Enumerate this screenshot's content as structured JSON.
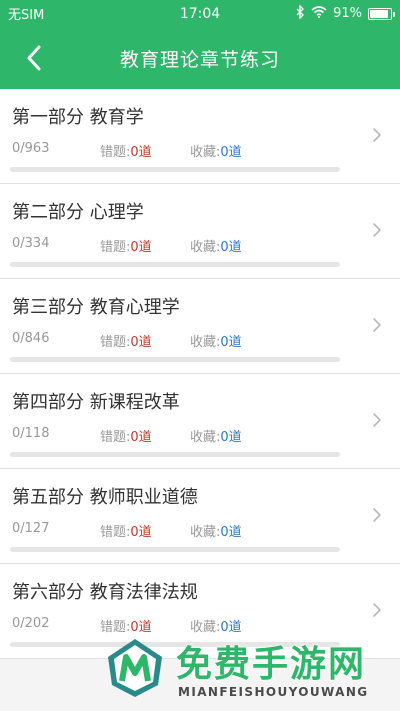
{
  "status_bar": {
    "carrier": "无SIM",
    "time": "17:04",
    "battery_percent": "91%",
    "battery_level": 0.91
  },
  "header": {
    "title": "教育理论章节练习"
  },
  "labels": {
    "wrong": "错题:",
    "fav": "收藏:"
  },
  "sections": [
    {
      "title": "第一部分 教育学",
      "progress": "0/963",
      "wrong": "0道",
      "fav": "0道",
      "done": 0
    },
    {
      "title": "第二部分 心理学",
      "progress": "0/334",
      "wrong": "0道",
      "fav": "0道",
      "done": 0
    },
    {
      "title": "第三部分 教育心理学",
      "progress": "0/846",
      "wrong": "0道",
      "fav": "0道",
      "done": 0
    },
    {
      "title": "第四部分 新课程改革",
      "progress": "0/118",
      "wrong": "0道",
      "fav": "0道",
      "done": 0
    },
    {
      "title": "第五部分 教师职业道德",
      "progress": "0/127",
      "wrong": "0道",
      "fav": "0道",
      "done": 0
    },
    {
      "title": "第六部分 教育法律法规",
      "progress": "0/202",
      "wrong": "0道",
      "fav": "0道",
      "done": 0
    }
  ],
  "watermark": {
    "title": "免费手游网",
    "subtitle": "MIANFEISHOUYOUWANG"
  },
  "colors": {
    "accent": "#2eb76a",
    "wrong": "#c0392b",
    "fav": "#2f78c4"
  },
  "icons": [
    "bluetooth-icon",
    "wifi-icon",
    "battery-icon",
    "back-arrow-icon",
    "chevron-right-icon"
  ]
}
